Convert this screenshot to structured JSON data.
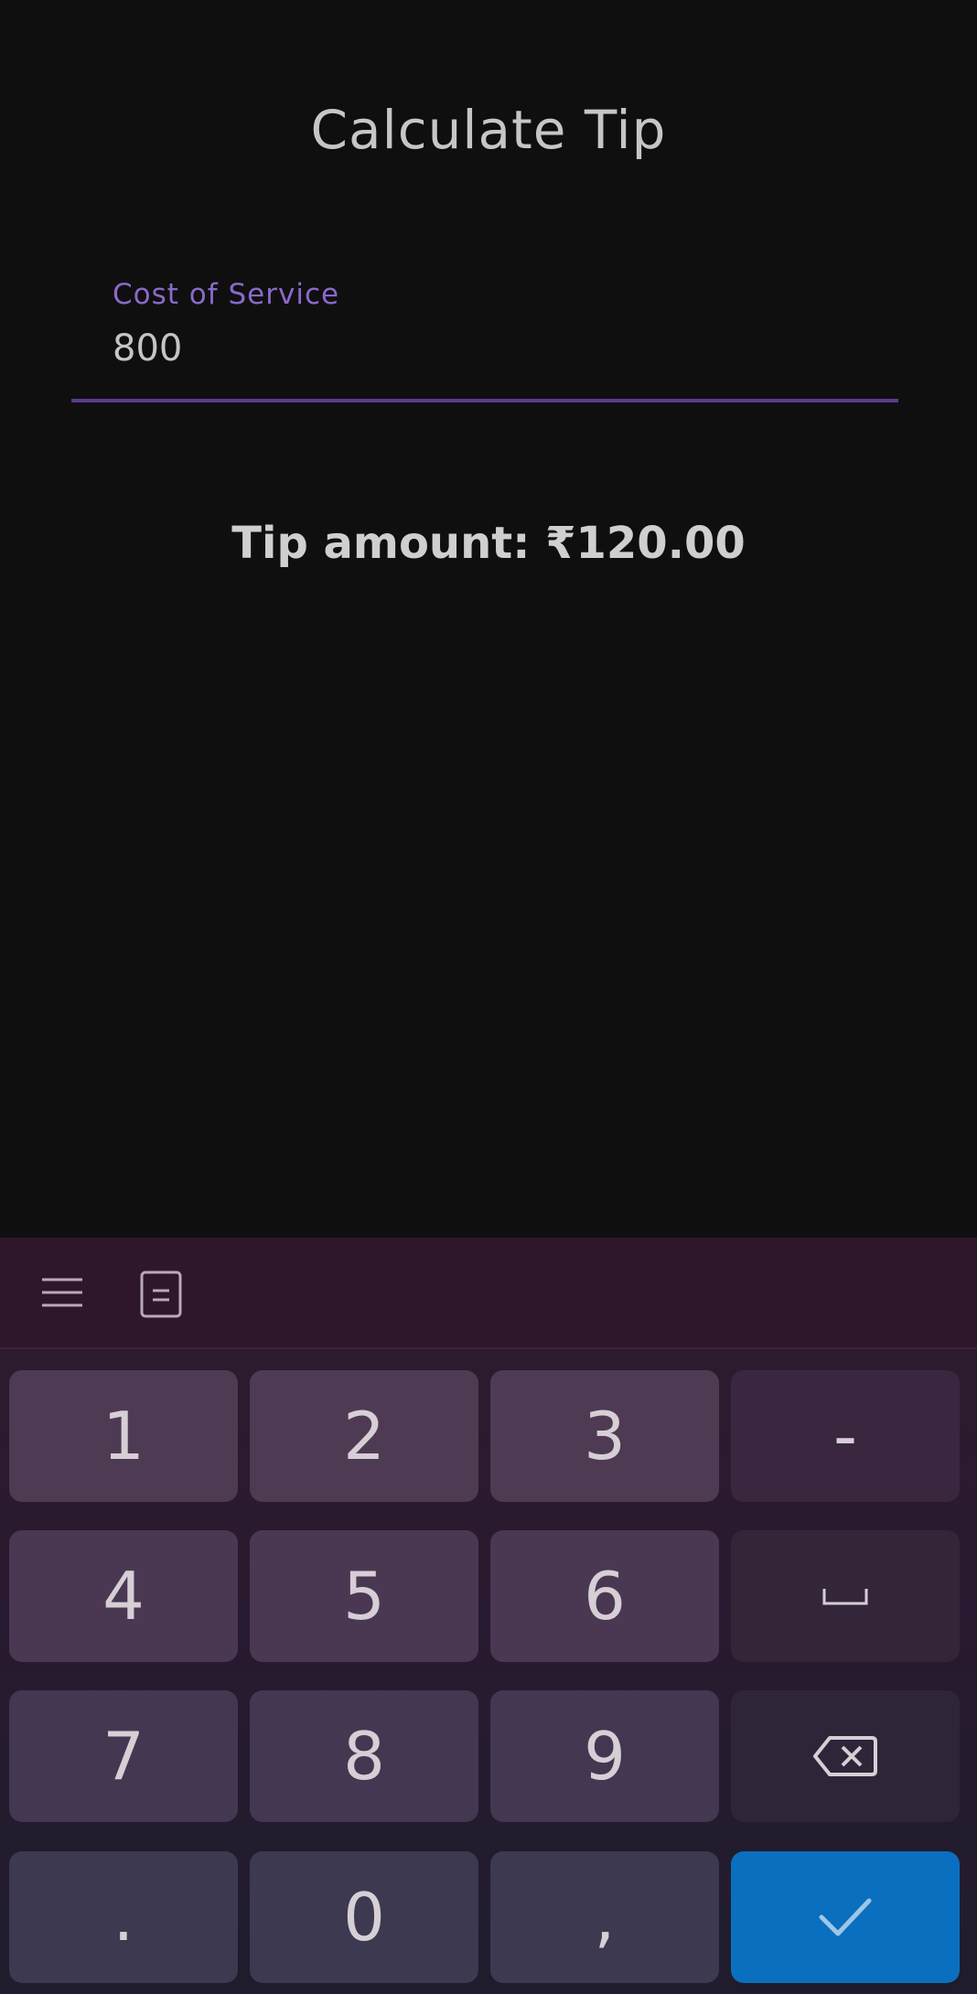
{
  "app": {
    "title": "Calculate Tip",
    "cost_field": {
      "label": "Cost of Service",
      "value": "800"
    },
    "tip_text": "Tip amount: ₹120.00"
  },
  "keyboard": {
    "toolbar": {
      "menu_icon": "menu-icon",
      "clipboard_icon": "clipboard-icon"
    },
    "keys": {
      "k1": "1",
      "k2": "2",
      "k3": "3",
      "minus": "-",
      "k4": "4",
      "k5": "5",
      "k6": "6",
      "space": "␣",
      "k7": "7",
      "k8": "8",
      "k9": "9",
      "backspace_icon": "backspace-icon",
      "dot": ".",
      "k0": "0",
      "comma": ",",
      "enter_icon": "check-icon"
    }
  },
  "colors": {
    "accent": "#8b69c9",
    "underline": "#5b3a8b",
    "enter_key": "#0a6fbe",
    "background": "#0f0f10"
  }
}
